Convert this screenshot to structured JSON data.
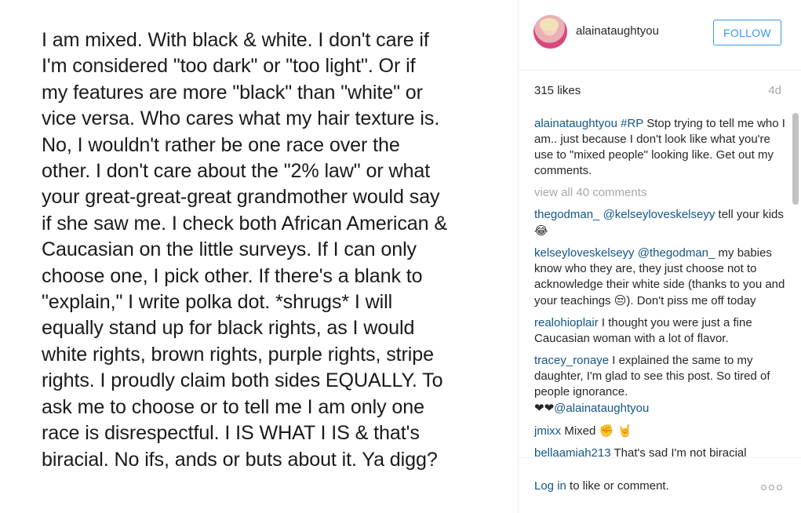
{
  "post_image": {
    "lines": [
      "I am mixed. With black & white. I don't care if",
      "I'm considered \"too dark\" or \"too light\". Or if",
      "my features are more \"black\" than \"white\" or",
      "vice versa. Who cares what my hair texture is.",
      "No, I wouldn't rather be one race over the",
      "other. I don't care about the \"2% law\" or what",
      "your great-great-great grandmother would say",
      "if she saw me. I check both African American &",
      "Caucasian on the little surveys. If I can only",
      "choose one, I pick other. If there's a blank to",
      "\"explain,\" I write polka dot. *shrugs* I will",
      "equally stand up for black rights, as I would",
      "white rights, brown rights, purple rights, stripe",
      "rights. I proudly claim both sides EQUALLY. To",
      "ask me to choose or to tell me I am only one",
      "race is disrespectful. I IS WHAT I IS & that's",
      "biracial. No ifs, ands or buts about it. Ya digg?"
    ]
  },
  "header": {
    "username": "alainataughtyou",
    "follow_label": "FOLLOW",
    "avatar_icon": "profile-avatar"
  },
  "stats": {
    "likes": "315 likes",
    "time": "4d"
  },
  "caption": {
    "user": "alainataughtyou",
    "hashtag": "#RP",
    "text": " Stop trying to tell me who I am.. just because I don't look like what you're use to \"mixed people\" looking like. Get out my comments."
  },
  "view_all": "view all 40 comments",
  "comments": [
    {
      "user": "thegodman_",
      "mention": "@kelseyloveskelseyy",
      "text": " tell your kids ",
      "emoji": "😂"
    },
    {
      "user": "kelseyloveskelseyy",
      "mention": "@thegodman_",
      "text": " my babies know who they are, they just choose not to acknowledge their white side (thanks to you and your teachings ",
      "emoji": "😒",
      "text2": "). Don't piss me off today"
    },
    {
      "user": "realohioplair",
      "text": " I thought you were just a fine Caucasian woman with a lot of flavor."
    },
    {
      "user": "tracey_ronaye",
      "text": " I explained the same to my daughter, I'm glad to see this post. So tired of people ignorance.",
      "emoji_prefix": "❤❤",
      "mention": "@alainataughtyou"
    },
    {
      "user": "jmixx",
      "text": " Mixed ",
      "emoji": "✊ 🤘"
    },
    {
      "user": "bellaamiah213",
      "text": " That's sad I'm not biracial"
    }
  ],
  "footer": {
    "login_link": "Log in",
    "login_rest": " to like or comment.",
    "more_icon": "more-options-icon"
  },
  "colors": {
    "link_blue": "#125688",
    "follow_blue": "#3897f0",
    "muted_gray": "#a5a7aa"
  }
}
